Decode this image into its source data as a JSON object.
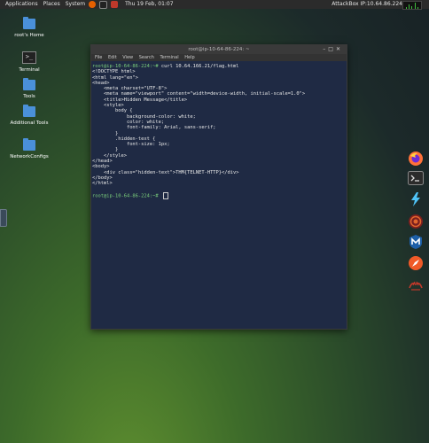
{
  "panel": {
    "applications": "Applications",
    "places": "Places",
    "system": "System",
    "datetime": "Thu 19 Feb, 01:07",
    "attackbox": "AttackBox IP:10.64.86.224"
  },
  "desktop": {
    "items": [
      {
        "label": "root's Home"
      },
      {
        "label": "Terminal"
      },
      {
        "label": "Tools"
      },
      {
        "label": "Additional Tools"
      },
      {
        "label": "NetworkConfigs"
      }
    ]
  },
  "terminal": {
    "title": "root@ip-10-64-86-224: ~",
    "menu": [
      "File",
      "Edit",
      "View",
      "Search",
      "Terminal",
      "Help"
    ],
    "prompt": "root@ip-10-64-86-224:~#",
    "command": " curl 10.64.166.21/flag.html",
    "output": "<!DOCTYPE html>\n<html lang=\"en\">\n<head>\n    <meta charset=\"UTF-8\">\n    <meta name=\"viewport\" content=\"width=device-width, initial-scale=1.0\">\n    <title>Hidden Message</title>\n    <style>\n        body {\n            background-color: white;\n            color: white;\n            font-family: Arial, sans-serif;\n        }\n        .hidden-text {\n            font-size: 1px;\n        }\n    </style>\n</head>\n<body>\n    <div class=\"hidden-text\">THM{TELNET-HTTP}</div>\n</body>\n</html>",
    "prompt2": "root@ip-10-64-86-224:~#"
  },
  "dock": {
    "icons": [
      "firefox-icon",
      "terminal-icon",
      "burp-icon",
      "tool-icon",
      "metasploit-icon",
      "compass-icon",
      "hydra-icon"
    ]
  }
}
